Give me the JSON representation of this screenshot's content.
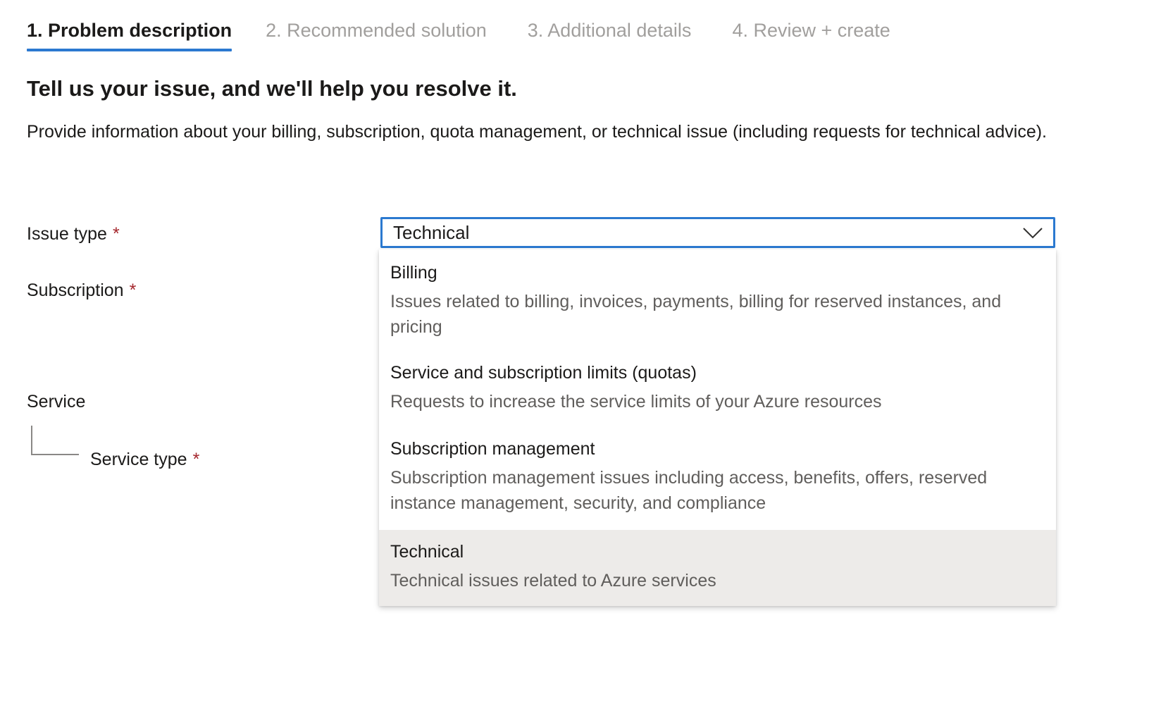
{
  "tabs": [
    {
      "label": "1. Problem description",
      "active": true
    },
    {
      "label": "2. Recommended solution",
      "active": false
    },
    {
      "label": "3. Additional details",
      "active": false
    },
    {
      "label": "4. Review + create",
      "active": false
    }
  ],
  "heading": "Tell us your issue, and we'll help you resolve it.",
  "intro": "Provide information about your billing, subscription, quota management, or technical issue (including requests for technical advice).",
  "form": {
    "issue_type_label": "Issue type",
    "subscription_label": "Subscription",
    "service_label": "Service",
    "service_type_label": "Service type",
    "required_marker": "*",
    "issue_type_value": "Technical"
  },
  "dropdown": {
    "options": [
      {
        "title": "Billing",
        "description": "Issues related to billing, invoices, payments, billing for reserved instances, and pricing"
      },
      {
        "title": "Service and subscription limits (quotas)",
        "description": "Requests to increase the service limits of your Azure resources"
      },
      {
        "title": "Subscription management",
        "description": "Subscription management issues including access, benefits, offers, reserved instance management, security, and compliance"
      },
      {
        "title": "Technical",
        "description": "Technical issues related to Azure services",
        "highlighted": true
      }
    ]
  },
  "colors": {
    "accent": "#2b79d0",
    "required": "#a4262c",
    "highlight": "#edebe9",
    "inactive_tab": "#a19f9d"
  },
  "icons": {
    "select_chevron": "chevron-down-icon"
  }
}
